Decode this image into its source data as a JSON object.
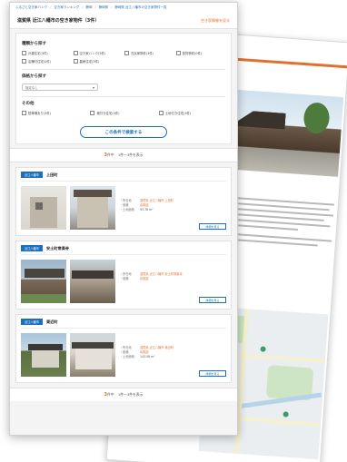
{
  "breadcrumb": [
    "ふるさと空き家バンク",
    "空き家ランキング",
    "静岡",
    "静岡県",
    "静岡県 近江八幡市の空き家物件一覧"
  ],
  "header": {
    "title": "滋賀県 近江八幡市の空き家物件（3件）",
    "link": "空き家情報を見る"
  },
  "search": {
    "type_heading": "種類から探す",
    "types": [
      "戸建住宅(3件)",
      "空き家バンク(3件)",
      "古民家物件(3件)",
      "賃貸物件(0件)",
      "店舗付住宅(0件)",
      "農家住宅(3件)"
    ],
    "price_heading": "価格から探す",
    "price_select": "指定なし",
    "other_heading": "その他",
    "others": [
      "駐車場あり(3件)",
      "畑付き住宅(0件)",
      "土地付き住宅(3件)"
    ],
    "button": "この条件で検索する"
  },
  "results": {
    "count": "3",
    "count_suffix": "件中",
    "range": "1件〜3件を表示"
  },
  "listings": [
    {
      "badge": "近江八幡市",
      "title": "上田町",
      "specs": [
        {
          "key": "・所在地",
          "val": "滋賀県 近江八幡市 上田町"
        },
        {
          "key": "・価格",
          "val": "応相談"
        },
        {
          "key": "・土地面積",
          "val": "93.78 m²"
        }
      ],
      "button": "詳細を見る"
    },
    {
      "badge": "近江八幡市",
      "title": "安土町常楽寺",
      "specs": [
        {
          "key": "・所在地",
          "val": "滋賀県 近江八幡市 安土町常楽寺"
        },
        {
          "key": "・価格",
          "val": "応相談"
        }
      ],
      "button": "詳細を見る"
    },
    {
      "badge": "近江八幡市",
      "title": "東近町",
      "specs": [
        {
          "key": "・所在地",
          "val": "滋賀県 近江八幡市 東近町"
        },
        {
          "key": "・価格",
          "val": "応相談"
        },
        {
          "key": "・土地面積",
          "val": "143.58 m²"
        }
      ],
      "button": "詳細を見る"
    }
  ],
  "footer": {
    "count": "3",
    "count_suffix": "件中",
    "range": "1件〜3件を表示"
  },
  "colors": {
    "accent": "#1a6fbf",
    "highlight": "#e0702c"
  }
}
